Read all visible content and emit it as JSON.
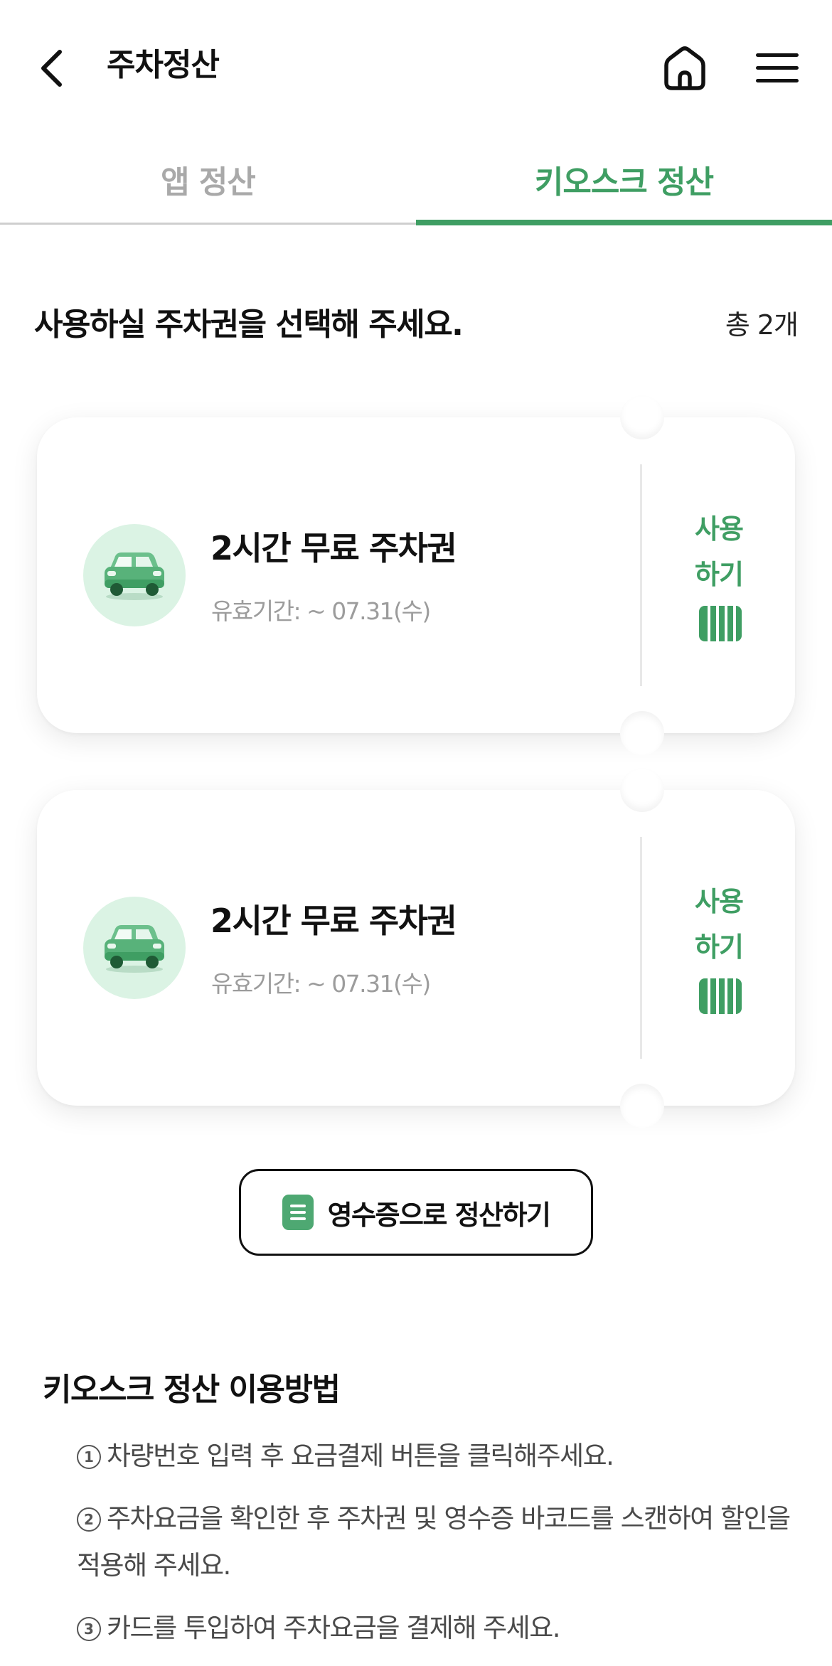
{
  "header": {
    "title": "주차정산",
    "back_icon": "chevron-left-icon",
    "home_icon": "home-icon",
    "menu_icon": "hamburger-menu-icon"
  },
  "tabs": [
    {
      "label": "앱 정산",
      "active": false
    },
    {
      "label": "키오스크 정산",
      "active": true
    }
  ],
  "ticket_section": {
    "title": "사용하실 주차권을 선택해 주세요.",
    "count": "총 2개"
  },
  "tickets": [
    {
      "name": "2시간 무료 주차권",
      "valid": "유효기간: ~ 07.31(수)",
      "use_label": "사용\n하기",
      "icon": "car-icon"
    },
    {
      "name": "2시간 무료 주차권",
      "valid": "유효기간: ~ 07.31(수)",
      "use_label": "사용\n하기",
      "icon": "car-icon"
    }
  ],
  "receipt_button": {
    "label": "영수증으로 정산하기",
    "icon": "receipt-icon"
  },
  "howto": {
    "title": "키오스크 정산 이용방법",
    "steps": [
      {
        "num": "1",
        "text": "차량번호 입력 후 요금결제 버튼을 클릭해주세요."
      },
      {
        "num": "2",
        "text": "주차요금을 확인한 후 주차권 및 영수증 바코드를 스캔하여 할인을 적용해 주세요."
      },
      {
        "num": "3",
        "text": "카드를 투입하여 주차요금을 결제해 주세요."
      }
    ]
  },
  "colors": {
    "accent": "#3f9e63",
    "accent_light": "#dbf3e4",
    "inactive_tab": "#a9a9a9"
  }
}
